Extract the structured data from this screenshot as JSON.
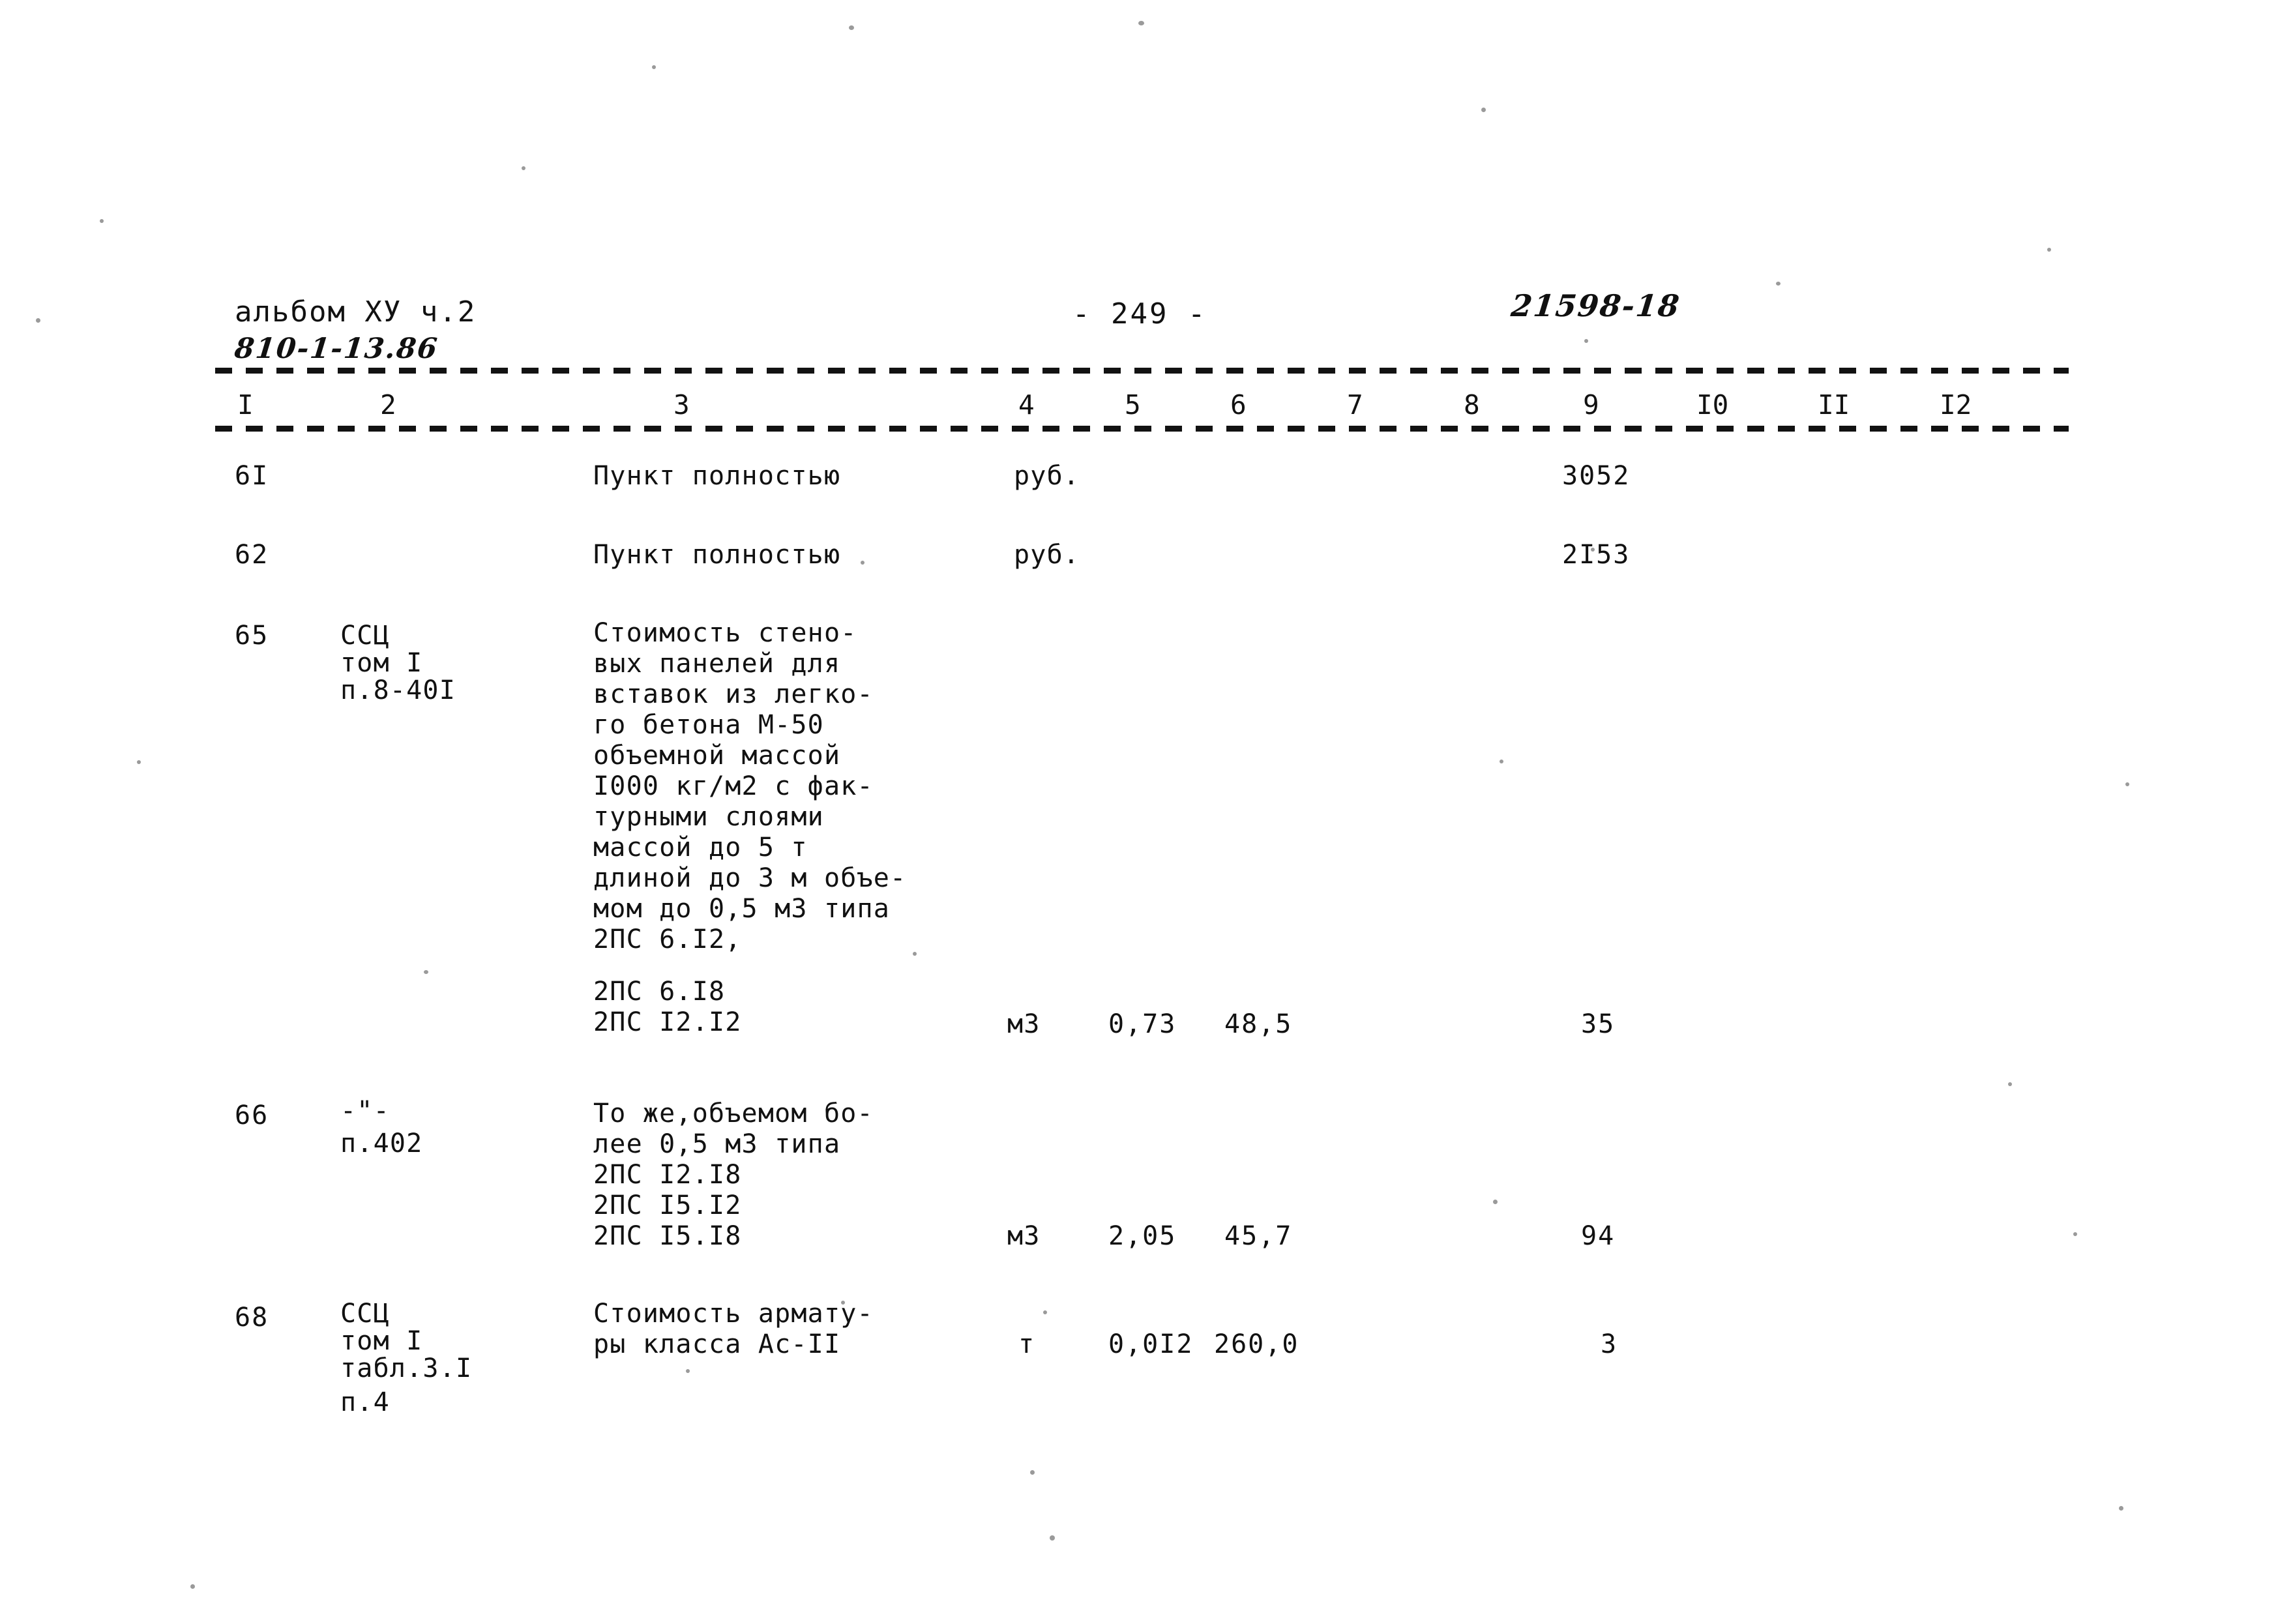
{
  "document": {
    "album_label": "альбом ХУ ч.2",
    "album_code": "810-1-13.86",
    "page_marker": "- 249 -",
    "stamp_code": "21598-18"
  },
  "table": {
    "column_headers": [
      "I",
      "2",
      "3",
      "4",
      "5",
      "6",
      "7",
      "8",
      "9",
      "I0",
      "II",
      "I2"
    ],
    "rows": [
      {
        "num": "6I",
        "ref": "",
        "description": "Пункт полностью",
        "unit": "руб.",
        "qty": "",
        "price": "",
        "col7": "",
        "col8": "",
        "total": "3052",
        "col10": "",
        "col11": "",
        "col12": ""
      },
      {
        "num": "62",
        "ref": "",
        "description": "Пункт полностью",
        "unit": "руб.",
        "qty": "",
        "price": "",
        "col7": "",
        "col8": "",
        "total": "2I53",
        "col10": "",
        "col11": "",
        "col12": ""
      },
      {
        "num": "65",
        "ref_lines": [
          "ССЦ",
          "том I",
          "п.8-40I"
        ],
        "description_lines": [
          "Стоимость стено-",
          "вых панелей для",
          "вставок из легко-",
          "го бетона М-50",
          "объемной массой",
          "I000 кг/м2 с фак-",
          "турными слоями",
          "массой до 5 т",
          "длиной до 3 м объе-",
          "мом до 0,5 м3 типа",
          "2ПС 6.I2,"
        ],
        "description_lines2": [
          "2ПС 6.I8",
          "2ПС I2.I2"
        ],
        "unit": "м3",
        "qty": "0,73",
        "price": "48,5",
        "col7": "",
        "col8": "",
        "total": "35",
        "col10": "",
        "col11": "",
        "col12": ""
      },
      {
        "num": "66",
        "ref_lines": [
          "-\"-",
          "п.402"
        ],
        "description_lines": [
          "То же,объемом бо-",
          "лее 0,5 м3 типа",
          "2ПС I2.I8",
          "2ПС I5.I2",
          "2ПС I5.I8"
        ],
        "unit": "м3",
        "qty": "2,05",
        "price": "45,7",
        "col7": "",
        "col8": "",
        "total": "94",
        "col10": "",
        "col11": "",
        "col12": ""
      },
      {
        "num": "68",
        "ref_lines": [
          "ССЦ",
          "том I",
          "табл.3.I",
          "п.4"
        ],
        "description_lines": [
          "Стоимость армату-",
          "ры класса Ас-II"
        ],
        "unit": "т",
        "qty": "0,0I2",
        "price": "260,0",
        "col7": "",
        "col8": "",
        "total": "3",
        "col10": "",
        "col11": "",
        "col12": ""
      }
    ]
  }
}
